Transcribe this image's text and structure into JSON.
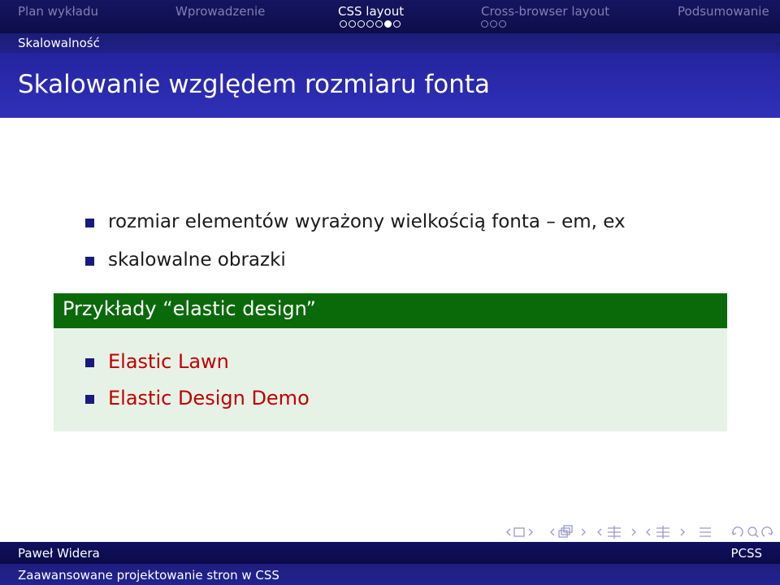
{
  "nav": {
    "sections": [
      {
        "label": "Plan wykładu"
      },
      {
        "label": "Wprowadzenie"
      },
      {
        "label": "CSS layout"
      },
      {
        "label": "Cross-browser layout"
      },
      {
        "label": "Podsumowanie"
      }
    ],
    "current_section": "CSS layout",
    "css_layout_frames": 7,
    "css_layout_current_frame": 6,
    "cross_browser_frames": 3
  },
  "subsection": "Skalowalność",
  "frame_title": "Skalowanie względem rozmiaru fonta",
  "bullets": [
    "rozmiar elementów wyrażony wielkością fonta – em, ex",
    "skalowalne obrazki"
  ],
  "example_block": {
    "title": "Przykłady “elastic design”",
    "links": [
      "Elastic Lawn",
      "Elastic Design Demo"
    ]
  },
  "footer": {
    "author": "Paweł Widera",
    "short_title": "PCSS",
    "title": "Zaawansowane projektowanie stron w CSS"
  },
  "colors": {
    "nav_bg": "#0d0d4a",
    "title_bg": "#2b2bb0",
    "block_head": "#0a6a0a",
    "block_body": "#e7f2e7",
    "link": "#c00000",
    "bullet": "#1a1a7e"
  }
}
